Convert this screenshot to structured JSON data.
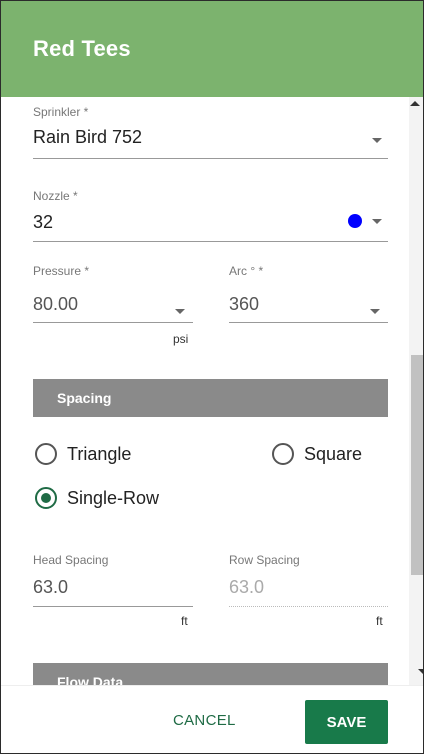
{
  "dialog": {
    "title": "Red Tees"
  },
  "form": {
    "sprinkler": {
      "label": "Sprinkler *",
      "value": "Rain Bird 752"
    },
    "nozzle": {
      "label": "Nozzle *",
      "value": "32",
      "color": "#0000ff"
    },
    "pressure": {
      "label": "Pressure *",
      "value": "80.00",
      "unit": "psi"
    },
    "arc": {
      "label": "Arc ° *",
      "value": "360"
    }
  },
  "spacing": {
    "header": "Spacing",
    "options": [
      {
        "label": "Triangle",
        "selected": false
      },
      {
        "label": "Square",
        "selected": false
      },
      {
        "label": "Single-Row",
        "selected": true
      }
    ],
    "head_spacing": {
      "label": "Head Spacing",
      "value": "63.0",
      "unit": "ft"
    },
    "row_spacing": {
      "label": "Row Spacing",
      "value": "63.0",
      "unit": "ft"
    }
  },
  "flow_data": {
    "header": "Flow Data"
  },
  "actions": {
    "cancel": "CANCEL",
    "save": "SAVE"
  },
  "colors": {
    "header_bg": "#7cb36e",
    "accent": "#187a4a",
    "section_bg": "#8a8a8a"
  }
}
